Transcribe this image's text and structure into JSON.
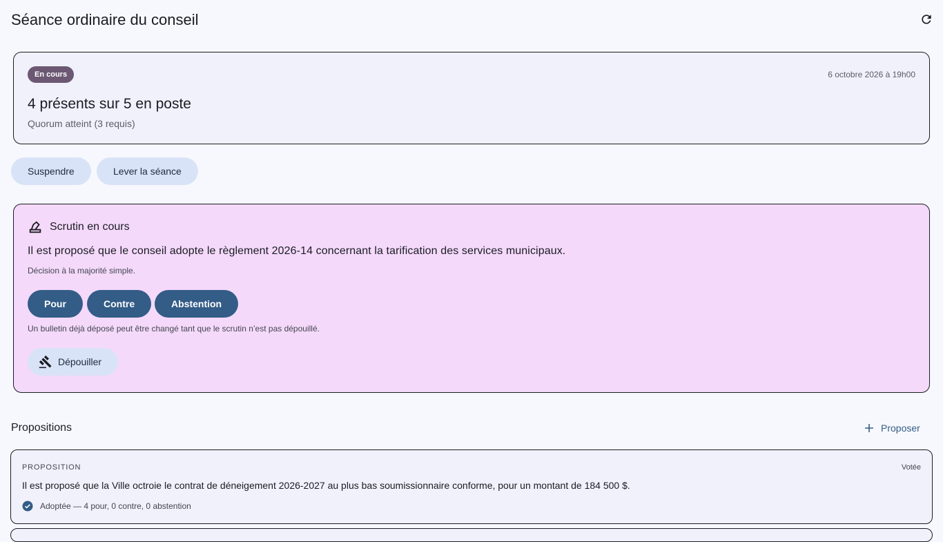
{
  "header": {
    "title": "Séance ordinaire du conseil",
    "refresh_icon": "refresh-icon"
  },
  "session": {
    "status": "En cours",
    "status_color": "#6c5873",
    "date": "6 octobre 2026 à 19h00",
    "attendance": "4 présents sur 5 en poste",
    "quorum": "Quorum atteint (3 requis)"
  },
  "actions": {
    "suspend_label": "Suspendre",
    "adjourn_label": "Lever la séance"
  },
  "vote": {
    "title": "Scrutin en cours",
    "icon": "ballot-box-icon",
    "motion": "Il est proposé que le conseil adopte le règlement 2026-14 concernant la tarification des services municipaux.",
    "rule": "Décision à la majorité simple.",
    "options": [
      "Pour",
      "Contre",
      "Abstention"
    ],
    "note": "Un bulletin déjà déposé peut être changé tant que le scrutin n’est pas dépouillé.",
    "count_label": "Dépouiller",
    "count_icon": "gavel-icon",
    "background": "#f4d9fb",
    "button_color": "#335c87"
  },
  "propositions": {
    "title": "Propositions",
    "propose_label": "Proposer",
    "items": [
      {
        "kicker": "PROPOSITION",
        "status": "Votée",
        "text": "Il est proposé que la Ville octroie le contrat de déneigement 2026-2027 au plus bas soumissionnaire conforme, pour un montant de 184 500 $.",
        "result": "Adoptée — 4 pour, 0 contre, 0 abstention"
      }
    ]
  }
}
